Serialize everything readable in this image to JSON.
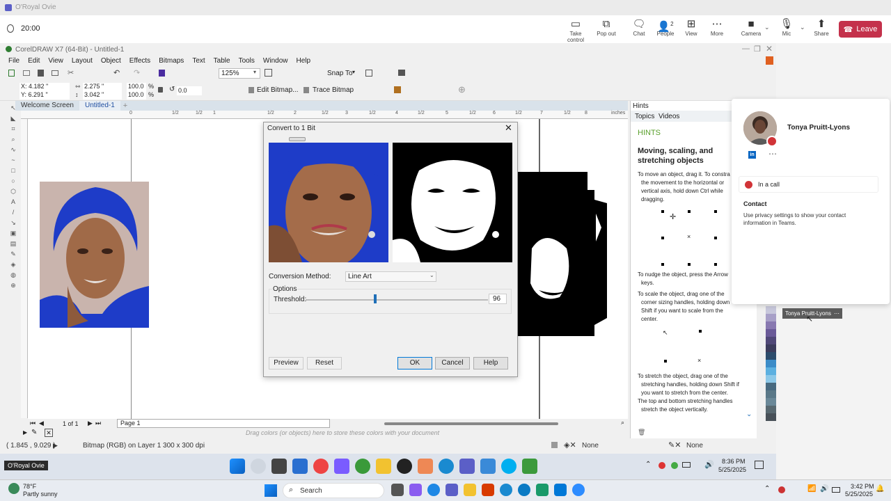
{
  "teams": {
    "window_title": "O'Royal Ovie",
    "timer": "20:00",
    "buttons": [
      {
        "label": "Take control",
        "icon": "take-control-icon"
      },
      {
        "label": "Pop out",
        "icon": "pop-out-icon"
      },
      {
        "label": "Chat",
        "icon": "chat-icon"
      },
      {
        "label": "People",
        "icon": "people-icon",
        "badge": "2"
      },
      {
        "label": "View",
        "icon": "view-icon"
      },
      {
        "label": "More",
        "icon": "more-icon"
      },
      {
        "label": "Camera",
        "icon": "camera-icon"
      },
      {
        "label": "Mic",
        "icon": "mic-icon"
      },
      {
        "label": "Share",
        "icon": "share-icon"
      }
    ],
    "leave_label": "Leave",
    "leave_color": "#c4314b"
  },
  "corel": {
    "title": "CorelDRAW X7 (64-Bit) - Untitled-1",
    "menu": [
      "File",
      "Edit",
      "View",
      "Layout",
      "Object",
      "Effects",
      "Bitmaps",
      "Text",
      "Table",
      "Tools",
      "Window",
      "Help"
    ],
    "zoom": "125%",
    "snap_to": "Snap To",
    "props": {
      "x": "X: 4.182 \"",
      "y": "Y: 6.291 \"",
      "w": "2.275 \"",
      "h": "3.042 \"",
      "sx": "100.0",
      "sy": "100.0",
      "pct1": "%",
      "pct2": "%",
      "angle": "0.0",
      "edit_bitmap": "Edit Bitmap...",
      "trace_bitmap": "Trace Bitmap"
    },
    "tabs": [
      "Welcome Screen",
      "Untitled-1"
    ],
    "ruler_labels": [
      "0",
      "1/2",
      "1",
      "1/2",
      "2",
      "1/2",
      "3",
      "1/2",
      "4",
      "1/2",
      "5",
      "1/2",
      "6",
      "1/2",
      "7",
      "1/2",
      "8",
      "1/2"
    ],
    "ruler_unit": "inches",
    "page_nav": {
      "count": "1 of 1",
      "page": "Page 1"
    },
    "palette_hint": "Drag colors (or objects) here to store these colors with your document",
    "status": {
      "coords": "( 1.845 , 9.029 )",
      "object": "Bitmap (RGB) on Layer 1 300 x 300 dpi",
      "fill": "None",
      "outline": "None"
    }
  },
  "dialog": {
    "title": "Convert to 1 Bit",
    "method_label": "Conversion Method:",
    "method_value": "Line Art",
    "options_label": "Options",
    "threshold_label": "Threshold:",
    "threshold_value": "96",
    "threshold_fraction": 0.38,
    "buttons": {
      "preview": "Preview",
      "reset": "Reset",
      "ok": "OK",
      "cancel": "Cancel",
      "help": "Help"
    }
  },
  "hints": {
    "panel_title": "Hints",
    "tabs": [
      "Topics",
      "Videos"
    ],
    "heading": "HINTS",
    "title": "Moving, scaling, and stretching objects",
    "p1_a": "To move an object, drag it. To constra",
    "p1_b": "the movement to the horizontal or",
    "p1_c": "vertical axis, hold down Ctrl while",
    "p1_d": "dragging.",
    "p2_a": "To nudge the object, press the Arrow",
    "p2_b": "keys.",
    "p3_a": "To scale the object, drag one of the",
    "p3_b": "corner sizing handles, holding down",
    "p3_c": "Shift if you want to scale from the",
    "p3_d": "center.",
    "p4_a": "To stretch the object, drag one of the",
    "p4_b": "stretching handles, holding down Shift if",
    "p4_c": "you want to stretch from the center.",
    "p5_a": "The top and bottom stretching handles",
    "p5_b": "stretch the object vertically."
  },
  "contact": {
    "name": "Tonya Pruitt-Lyons",
    "status": "In a call",
    "contact_heading": "Contact",
    "contact_text": "Use privacy settings to show your contact information in Teams.",
    "tooltip": "Tonya Pruitt-Lyons",
    "status_color": "#d13438"
  },
  "inner_taskbar": {
    "app_label": "O'Royal Ovie",
    "time": "8:36 PM",
    "date": "5/25/2025"
  },
  "outer_taskbar": {
    "temp": "78°F",
    "weather": "Partly sunny",
    "search": "Search",
    "time": "3:42 PM",
    "date": "5/25/2025"
  }
}
